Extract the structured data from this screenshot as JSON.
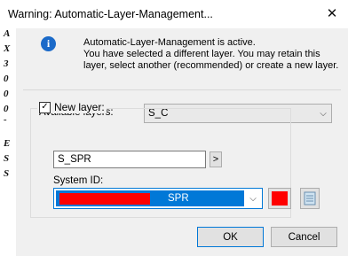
{
  "window": {
    "title": "Warning: Automatic-Layer-Management...",
    "close_glyph": "✕"
  },
  "side_strip": {
    "chars": [
      "A",
      "X",
      "3",
      "0",
      "0",
      "0",
      "-",
      "E",
      "S",
      "S"
    ]
  },
  "message": {
    "icon": "info-icon",
    "icon_glyph": "i",
    "line1": "Automatic-Layer-Management is active.",
    "line2": "You have selected a different layer. You may retain this layer, select another (recommended) or create a new layer."
  },
  "available_layers": {
    "label": "Available layers:",
    "value": "S_C"
  },
  "new_layer": {
    "checkbox_label": "New layer:",
    "checked": true,
    "name_value": "S_SPR",
    "more_button": ">"
  },
  "system_id": {
    "label": "System ID:",
    "value": "SPR",
    "swatch_color": "#ff0000",
    "selection_color": "#0078d7"
  },
  "buttons": {
    "ok": "OK",
    "cancel": "Cancel"
  }
}
